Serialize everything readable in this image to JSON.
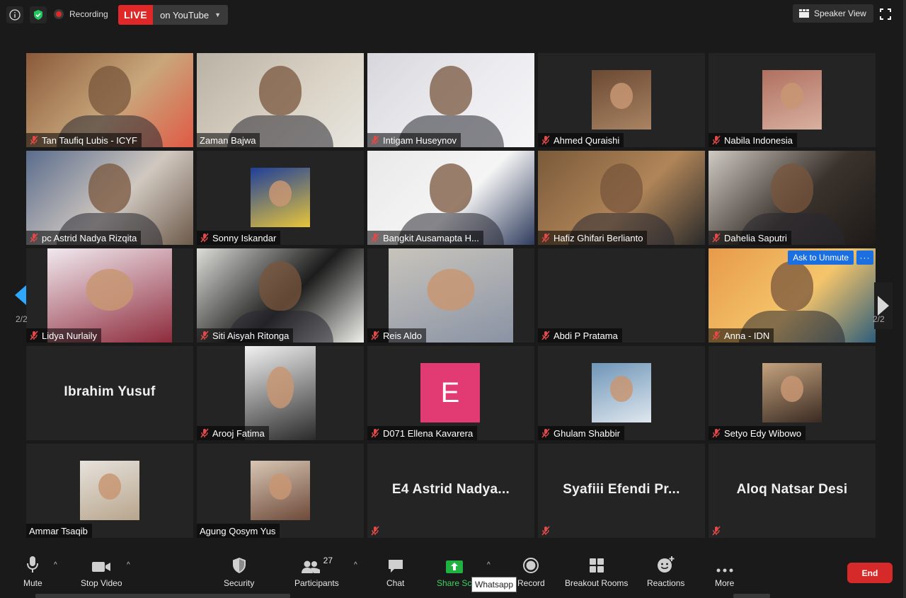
{
  "topbar": {
    "recording_label": "Recording",
    "live_label": "LIVE",
    "live_destination": "on YouTube",
    "speaker_view_label": "Speaker View"
  },
  "pagination": {
    "left": "2/2",
    "right": "2/2"
  },
  "tiles": [
    {
      "name": "Tan Taufiq Lubis - ICYF",
      "muted": true,
      "kind": "video",
      "colors": [
        "#8a5a3a",
        "#c9a77b",
        "#e05a45"
      ]
    },
    {
      "name": "Zaman Bajwa",
      "muted": false,
      "kind": "video",
      "colors": [
        "#b9b1a4",
        "#d9d2c4",
        "#e8e6e0"
      ]
    },
    {
      "name": "Intigam Huseynov",
      "muted": true,
      "kind": "video",
      "colors": [
        "#d6d6dc",
        "#ececf0",
        "#f5f5f7"
      ]
    },
    {
      "name": "Ahmed Quraishi",
      "muted": true,
      "kind": "photo",
      "colors": [
        "#6b4a33",
        "#a98363"
      ]
    },
    {
      "name": "Nabila Indonesia",
      "muted": true,
      "kind": "photo",
      "colors": [
        "#b07060",
        "#d9b0a0"
      ]
    },
    {
      "name": "pc Astrid Nadya Rizqita",
      "muted": true,
      "kind": "video",
      "colors": [
        "#5a6c8c",
        "#d0c8c0",
        "#6d5a4a"
      ]
    },
    {
      "name": "Sonny Iskandar",
      "muted": true,
      "kind": "photo",
      "colors": [
        "#1e3f9a",
        "#e8c53a"
      ]
    },
    {
      "name": "Bangkit Ausamapta H...",
      "muted": true,
      "kind": "video",
      "colors": [
        "#e9e9e9",
        "#f5f5f5",
        "#2e3b5c"
      ]
    },
    {
      "name": "Hafiz Ghifari Berlianto",
      "muted": true,
      "kind": "video",
      "colors": [
        "#7a5a3a",
        "#b08558",
        "#2a2a2a"
      ]
    },
    {
      "name": "Dahelia Saputri",
      "muted": true,
      "kind": "video",
      "colors": [
        "#cfcac3",
        "#3a322c",
        "#1e1a18"
      ]
    },
    {
      "name": "Lidya Nurlaily",
      "muted": true,
      "kind": "photo_wide",
      "colors": [
        "#f1e9ef",
        "#8e2b3c"
      ]
    },
    {
      "name": "Siti Aisyah Ritonga",
      "muted": true,
      "kind": "video",
      "colors": [
        "#dcdcd8",
        "#1c1c1c",
        "#f0f0ec"
      ]
    },
    {
      "name": "Reis Aldo",
      "muted": true,
      "kind": "photo_wide",
      "colors": [
        "#c8c4bc",
        "#8a93a4"
      ]
    },
    {
      "name": "Abdi P Pratama",
      "muted": true,
      "kind": "none",
      "colors": []
    },
    {
      "name": "Anna - IDN",
      "muted": true,
      "kind": "video",
      "colors": [
        "#e79a4a",
        "#f5c56b",
        "#2e5d7a"
      ],
      "ask_unmute": "Ask to Unmute"
    },
    {
      "name": "",
      "muted": false,
      "kind": "bigname",
      "big": "Ibrahim Yusuf",
      "colors": []
    },
    {
      "name": "Arooj Fatima",
      "muted": true,
      "kind": "photo_tall",
      "colors": [
        "#f2f2f2",
        "#2a2a2a"
      ]
    },
    {
      "name": "D071 Ellena Kavarera",
      "muted": true,
      "kind": "avatar",
      "letter": "E",
      "colors": [
        "#e23b73"
      ]
    },
    {
      "name": "Ghulam Shabbir",
      "muted": true,
      "kind": "photo",
      "colors": [
        "#6e95b8",
        "#dfe7ee"
      ]
    },
    {
      "name": "Setyo Edy Wibowo",
      "muted": true,
      "kind": "photo",
      "colors": [
        "#c4a37e",
        "#3a2a22"
      ]
    },
    {
      "name": "Ammar Tsaqib",
      "muted": false,
      "kind": "photo",
      "colors": [
        "#e6e2dc",
        "#b8a58c"
      ]
    },
    {
      "name": "Agung Qosym Yus",
      "muted": false,
      "kind": "photo",
      "colors": [
        "#d8c6b4",
        "#6e4a3a"
      ]
    },
    {
      "name": "",
      "muted": true,
      "kind": "bigname",
      "big": "E4  Astrid  Nadya...",
      "colors": []
    },
    {
      "name": "",
      "muted": true,
      "kind": "bigname",
      "big": "Syafiii  Efendi  Pr...",
      "colors": []
    },
    {
      "name": "",
      "muted": true,
      "kind": "bigname",
      "big": "Aloq Natsar Desi",
      "colors": []
    }
  ],
  "toolbar": {
    "mute": "Mute",
    "stop_video": "Stop Video",
    "security": "Security",
    "participants": "Participants",
    "participants_count": "27",
    "chat": "Chat",
    "share_screen": "Share Sc",
    "record": "Record",
    "breakout_rooms": "Breakout Rooms",
    "reactions": "Reactions",
    "more": "More",
    "end": "End",
    "tooltip": "Whatsapp"
  },
  "colors": {
    "background": "#1a1a1a",
    "tile": "#242424",
    "live_red": "#e02828",
    "share_green": "#1fb141",
    "end_red": "#d62a2a",
    "accent_blue": "#1b6fe0"
  }
}
